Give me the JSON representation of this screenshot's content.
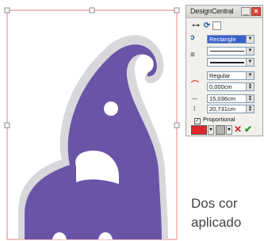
{
  "palette": {
    "title": "DesignCentral",
    "shape_type": "Rectangle",
    "line_style": "Regular",
    "corner_value": "0,000cm",
    "width_value": "15,036cm",
    "height_value": "20,731cm",
    "proportional_label": "Proportional",
    "proportional_checked": true,
    "fill_color": "#e0262a",
    "stroke_color": "#b4b4b4"
  },
  "caption": {
    "line1": "Dos cor",
    "line2": "aplicado"
  },
  "artwork": {
    "shape": "elephant-icon",
    "fill_color": "#6a54a8",
    "outline_color": "#d8d8dc",
    "selection_color": "#e08080"
  }
}
